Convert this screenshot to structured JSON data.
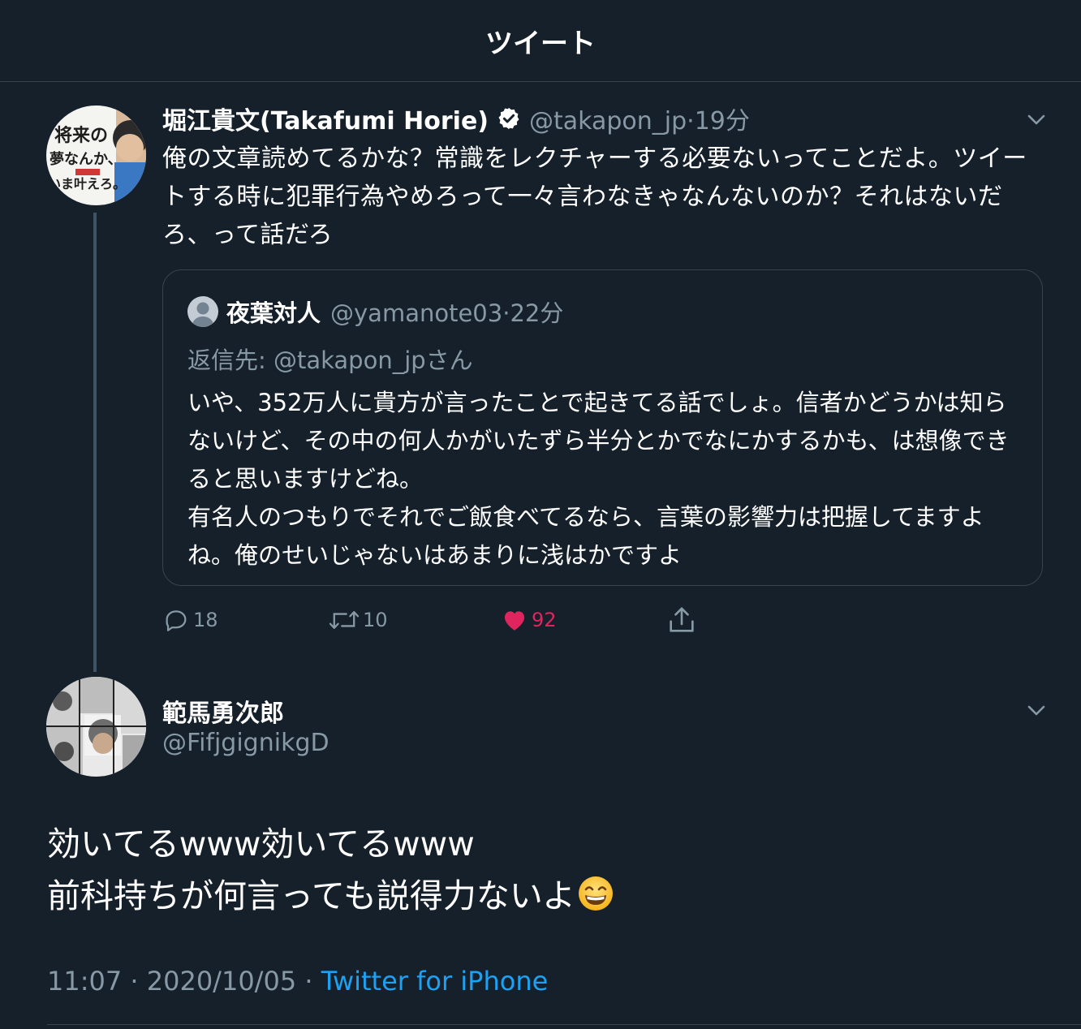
{
  "header": {
    "title": "ツイート"
  },
  "tweet1": {
    "name": "堀江貴文(Takafumi Horie)",
    "handle": "@takapon_jp",
    "time": "19分",
    "body": "俺の文章読めてるかな？常識をレクチャーする必要ないってことだよ。ツイートする時に犯罪行為やめろって一々言わなきゃなんないのか？それはないだろ、って話だろ",
    "avatar_text": [
      "将来の",
      "夢なんか、",
      "いま叶えろ。"
    ],
    "quote": {
      "name": "夜葉対人",
      "handle": "@yamanote03",
      "time": "22分",
      "reply_to": "返信先: @takapon_jpさん",
      "body": "いや、352万人に貴方が言ったことで起きてる話でしょ。信者かどうかは知らないけど、その中の何人かがいたずら半分とかでなにかするかも、は想像できると思いますけどね。\n有名人のつもりでそれでご飯食べてるなら、言葉の影響力は把握してますよね。俺のせいじゃないはあまりに浅はかですよ"
    },
    "actions": {
      "replies": "18",
      "retweets": "10",
      "likes": "92"
    }
  },
  "tweet2": {
    "name": "範馬勇次郎",
    "handle": "@FifjgignikgD",
    "body_line1": "効いてるwww効いてるwww",
    "body_line2": "前科持ちが何言っても説得力ないよ",
    "emoji": "grinning-face-with-smiling-eyes",
    "time": "11:07",
    "date": "2020/10/05",
    "source": "Twitter for iPhone"
  },
  "colors": {
    "background": "#15202b",
    "border": "#38444d",
    "secondary_text": "#8899a6",
    "accent": "#1da1f2",
    "like": "#e0245e"
  }
}
